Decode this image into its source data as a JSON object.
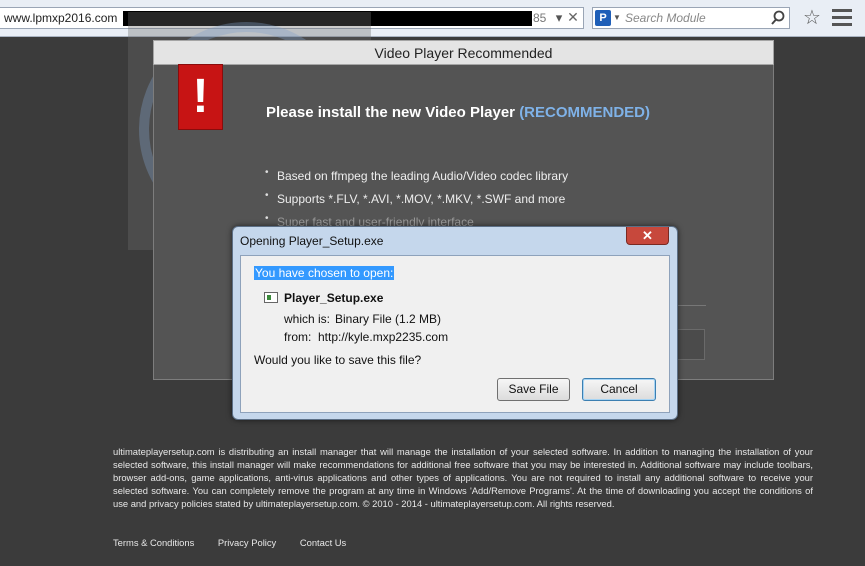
{
  "browser": {
    "url_text": "www.lpmxp2016.com",
    "url_suffix": "85",
    "search_placeholder": "Search Module"
  },
  "page": {
    "card_title": "Video Player Recommended",
    "headline": "Please install the new Video Player",
    "headline_tag": "(RECOMMENDED)",
    "features": [
      "Based on ffmpeg the leading Audio/Video codec library",
      "Supports *.FLV, *.AVI, *.MOV, *.MKV, *.SWF and more",
      "Super fast and user-friendly interface"
    ],
    "disclaimer": "ultimateplayersetup.com is distributing an install manager that will manage the installation of your selected software. In addition to managing the installation of your selected software, this install manager will make recommendations for additional free software that you may be interested in. Additional software may include toolbars, browser add-ons, game applications, anti-virus applications and other types of applications. You are not required to install any additional software to receive your selected software. You can completely remove the program at any time in Windows 'Add/Remove Programs'. At the time of downloading you accept the conditions of use and privacy policies stated by ultimateplayersetup.com. © 2010 - 2014 - ultimateplayersetup.com. All rights reserved.",
    "footer_links": [
      "Terms & Conditions",
      "Privacy Policy",
      "Contact Us"
    ]
  },
  "dialog": {
    "title": "Opening Player_Setup.exe",
    "chosen_label": "You have chosen to open:",
    "filename": "Player_Setup.exe",
    "which_is_label": "which is:",
    "which_is_value": "Binary File (1.2 MB)",
    "from_label": "from:",
    "from_value": "http://kyle.mxp2235.com",
    "question": "Would you like to save this file?",
    "save_label": "Save File",
    "cancel_label": "Cancel"
  },
  "colors": {
    "page_bg": "#3b3b3b",
    "recommended_accent": "#7fb2e8",
    "alert_red": "#c71414",
    "selection_blue": "#3399ff"
  },
  "icons": {
    "search_engine": "search-engine-icon",
    "bookmark": "star-icon",
    "menu": "menu-icon",
    "alert": "exclamation-icon",
    "file": "executable-file-icon"
  }
}
